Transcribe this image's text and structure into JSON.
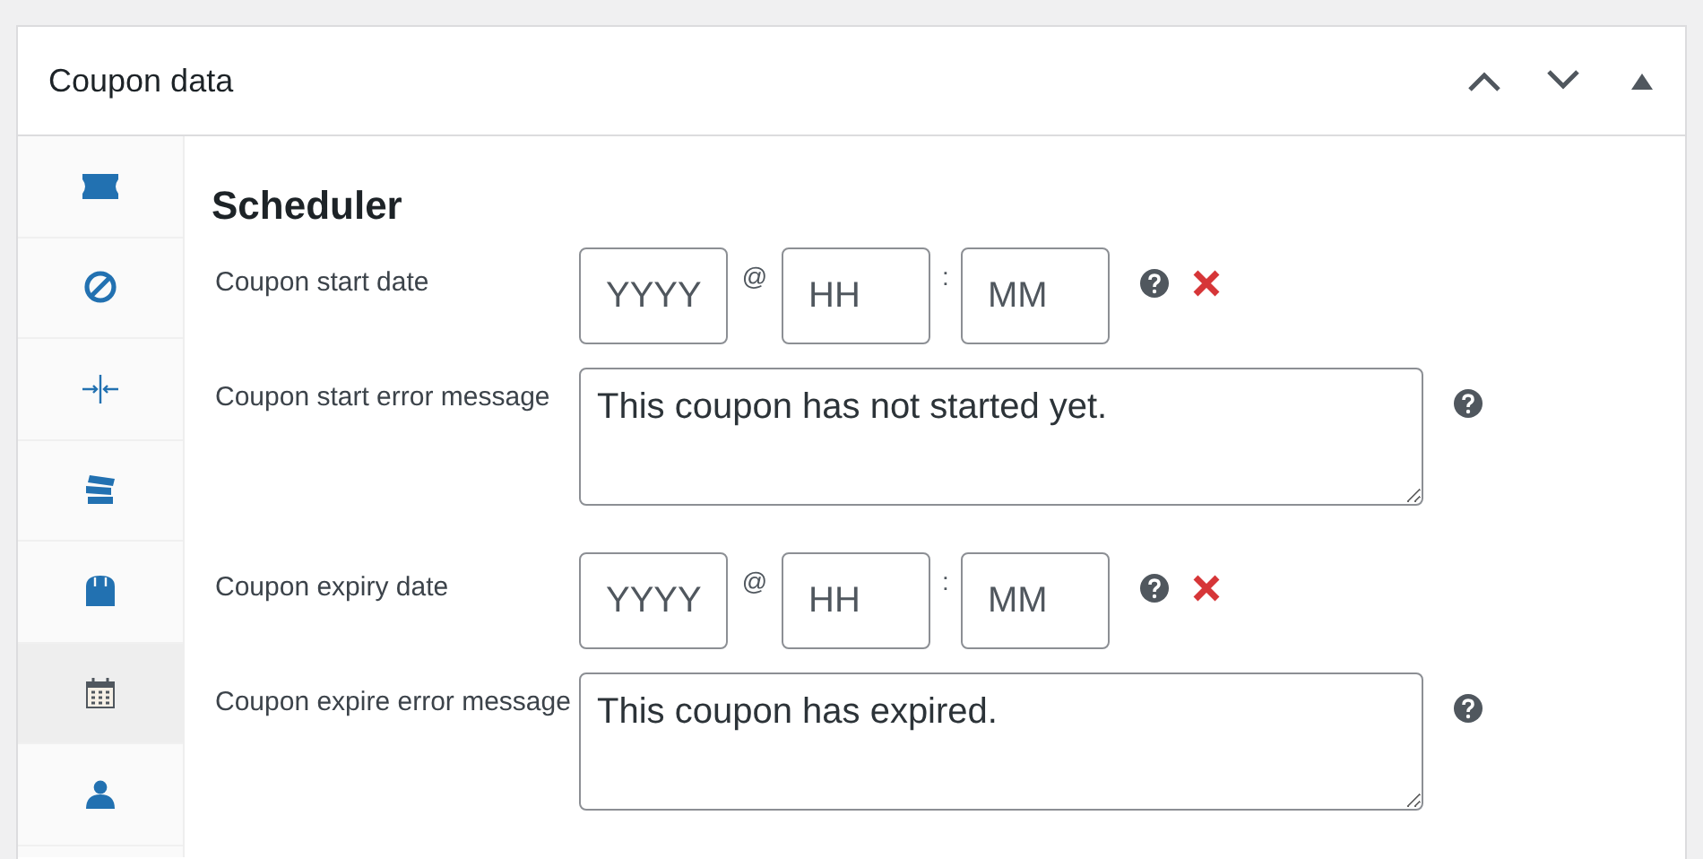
{
  "panel": {
    "title": "Coupon data"
  },
  "sidebar": {
    "items": [
      {
        "selected": false
      },
      {
        "selected": false
      },
      {
        "selected": false
      },
      {
        "selected": false
      },
      {
        "selected": false
      },
      {
        "selected": true
      },
      {
        "selected": false
      }
    ]
  },
  "section": {
    "heading": "Scheduler"
  },
  "fields": [
    {
      "kind": "datetime",
      "label": "Coupon start date",
      "date_placeholder": "YYYY",
      "at": "@",
      "hour_placeholder": "HH",
      "colon": ":",
      "minute_placeholder": "MM"
    },
    {
      "kind": "message",
      "label": "Coupon start error message",
      "value": "This coupon has not started yet."
    },
    {
      "kind": "datetime",
      "label": "Coupon expiry date",
      "date_placeholder": "YYYY",
      "at": "@",
      "hour_placeholder": "HH",
      "colon": ":",
      "minute_placeholder": "MM"
    },
    {
      "kind": "message",
      "label": "Coupon expire error message",
      "value": "This coupon has expired."
    }
  ]
}
